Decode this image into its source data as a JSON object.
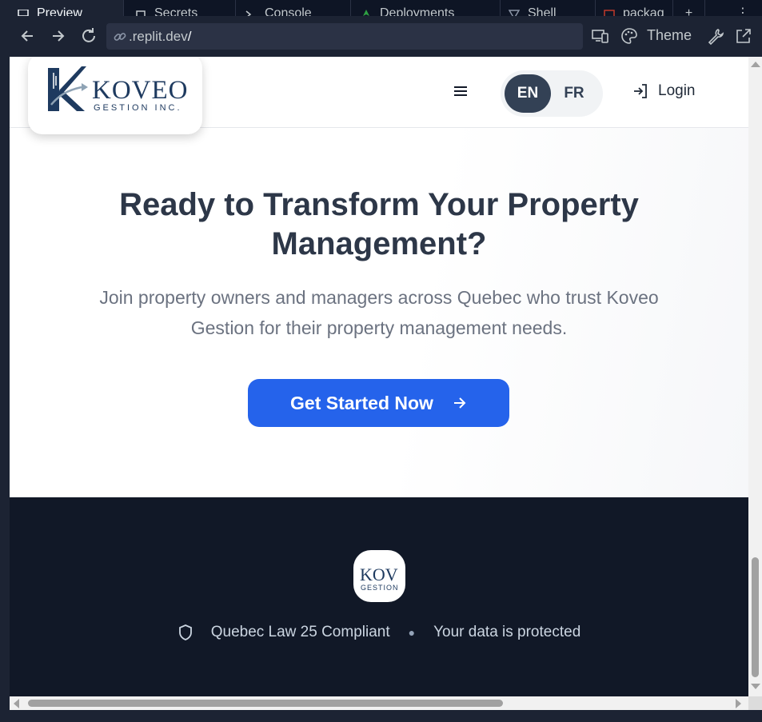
{
  "ide_tabs": [
    {
      "label": "Preview",
      "icon": "monitor-icon",
      "active": true
    },
    {
      "label": "Secrets",
      "icon": "lock-icon",
      "active": false
    },
    {
      "label": "Console",
      "icon": "terminal-icon",
      "active": false
    },
    {
      "label": "Deployments",
      "icon": "rocket-icon",
      "active": false
    },
    {
      "label": "Shell",
      "icon": "shell-icon",
      "active": false
    },
    {
      "label": "packag",
      "icon": "package-icon",
      "active": false
    }
  ],
  "browser": {
    "url": ".replit.dev",
    "url_slash": "/",
    "theme_label": "Theme"
  },
  "header": {
    "logo_wordmark": "KOVEO",
    "logo_sub": "GESTION INC.",
    "languages": {
      "en": "EN",
      "fr": "FR",
      "selected": "EN"
    },
    "login_label": "Login"
  },
  "cta": {
    "title_line1": "Ready to Transform Your Property",
    "title_line2": "Management?",
    "description_line1": "Join property owners and managers across Quebec who trust Koveo",
    "description_line2": "Gestion for their property management needs.",
    "button_label": "Get Started Now"
  },
  "footer": {
    "logo_wordmark": "KOV",
    "logo_sub": "GESTION",
    "compliance_text": "Quebec Law 25 Compliant",
    "protection_text": "Your data is protected"
  },
  "colors": {
    "primary": "#2563eb",
    "heading": "#2d3748",
    "footer_bg": "#111827",
    "lang_selected_bg": "#334155",
    "brand_navy": "#1e3a5f"
  }
}
